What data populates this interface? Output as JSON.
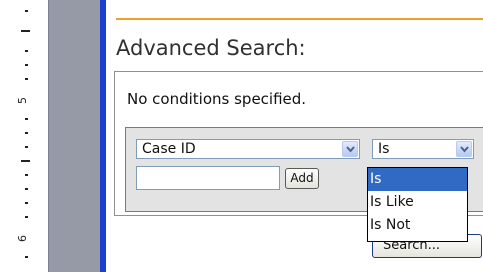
{
  "ruler": {
    "labels": [
      "5",
      "6"
    ]
  },
  "search": {
    "title": "Advanced Search:",
    "no_conditions": "No conditions specified.",
    "field_select": {
      "value": "Case ID"
    },
    "operator_select": {
      "value": "Is",
      "options": [
        "Is",
        "Is Like",
        "Is Not"
      ],
      "highlighted": "Is"
    },
    "value_input": {
      "value": ""
    },
    "add_label": "Add",
    "search_label": "Search..."
  },
  "colors": {
    "accent_rule": "#f0a030",
    "page_edge": "#1d3fd1",
    "selection": "#316ac5"
  }
}
